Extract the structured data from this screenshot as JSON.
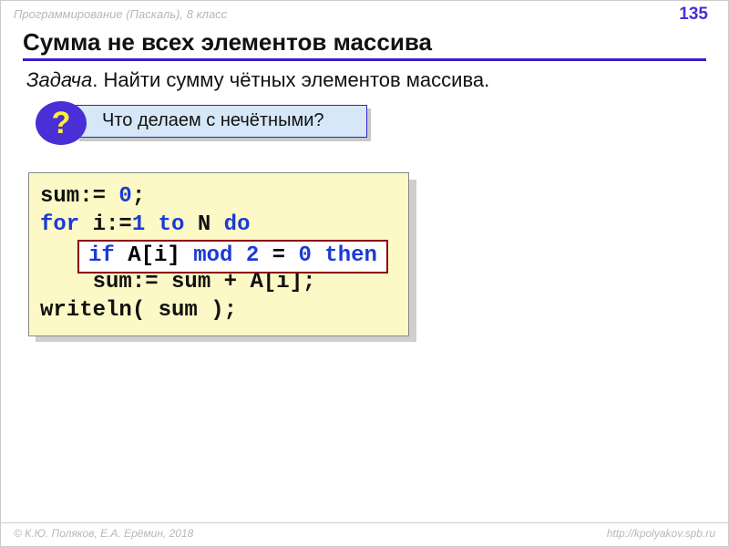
{
  "header": {
    "course": "Программирование (Паскаль), 8 класс",
    "page": "135"
  },
  "title": "Сумма не всех элементов массива",
  "task": {
    "label": "Задача",
    "text": ". Найти сумму чётных элементов массива."
  },
  "question": {
    "mark": "?",
    "text": "Что делаем с нечётными?"
  },
  "code": {
    "l1a": "sum:= ",
    "l1b": "0",
    "l1c": ";",
    "l2a": "for",
    "l2b": " i:=",
    "l2c": "1",
    "l2d": " ",
    "l2e": "to",
    "l2f": " N ",
    "l2g": "do",
    "l3_spacer": " ",
    "l4": "    sum:= sum + A[i];",
    "l5": "writeln( sum );"
  },
  "highlight": {
    "a": "if",
    "b": " A[i] ",
    "c": "mod",
    "d": " ",
    "e": "2",
    "f": " = ",
    "g": "0",
    "h": " ",
    "i": "then"
  },
  "footer": {
    "left": "© К.Ю. Поляков, Е.А. Ерёмин, 2018",
    "right": "http://kpolyakov.spb.ru"
  }
}
